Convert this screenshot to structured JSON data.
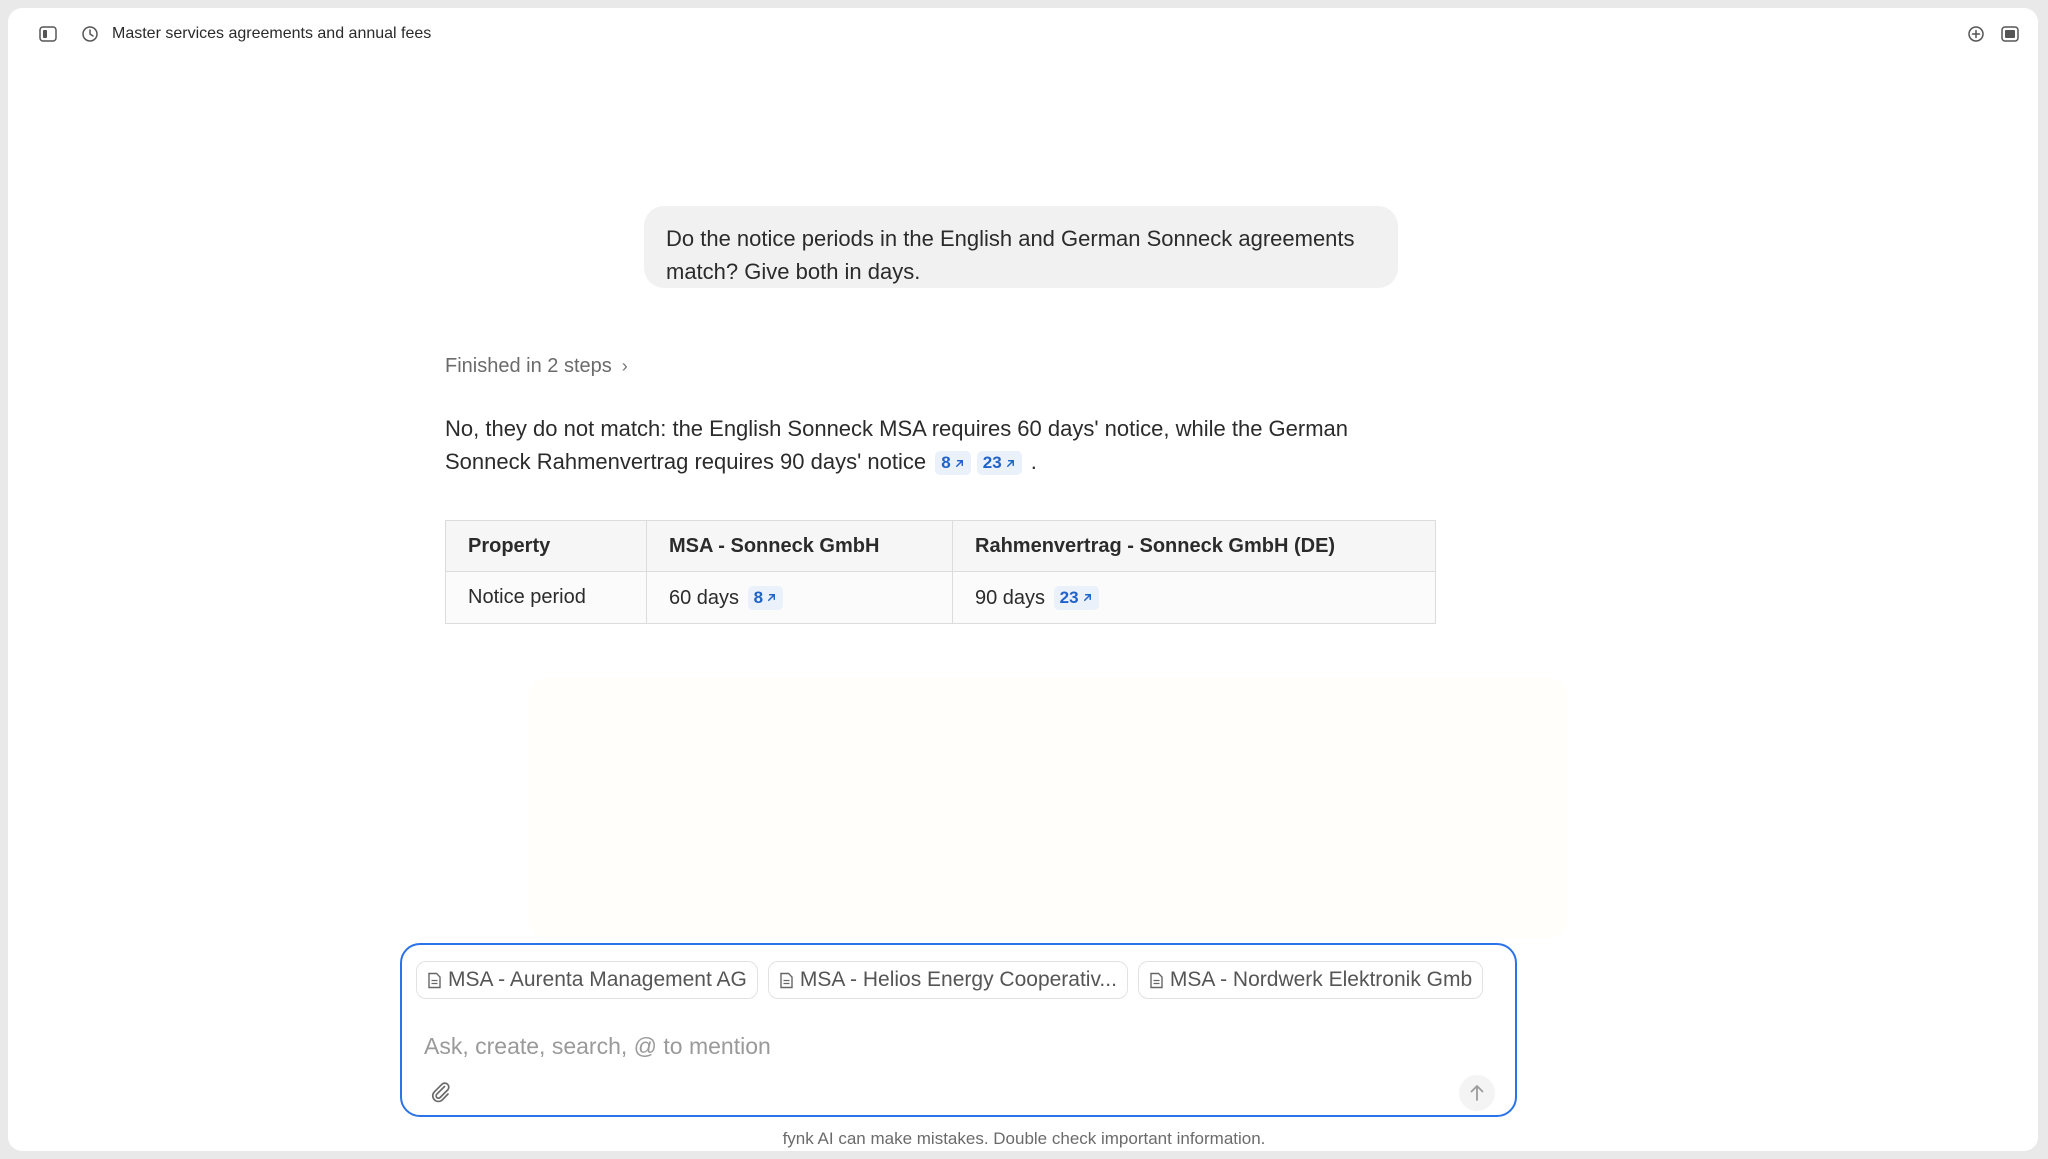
{
  "header": {
    "title": "Master services agreements and annual fees",
    "icons": [
      "sidebar-toggle-icon",
      "history-icon",
      "new-chat-icon",
      "panel-icon"
    ]
  },
  "conversation": {
    "user_message": "Do the notice periods in the English and German Sonneck agreements match? Give both in days.",
    "steps_label": "Finished in 2 steps",
    "answer_text": "No, they do not match: the English Sonneck MSA requires 60 days' notice, while the German Sonneck Rahmenvertrag requires 90 days' notice",
    "answer_end": ".",
    "answer_citations": [
      "8",
      "23"
    ]
  },
  "table": {
    "headers": [
      "Property",
      "MSA - Sonneck GmbH",
      "Rahmenvertrag - Sonneck GmbH (DE)"
    ],
    "rows": [
      {
        "property": "Notice period",
        "msa": "60 days",
        "msa_cite": "8",
        "rahmen": "90 days",
        "rahmen_cite": "23"
      }
    ]
  },
  "composer": {
    "chips": [
      "MSA - Aurenta Management AG",
      "MSA - Helios Energy Cooperativ...",
      "MSA - Nordwerk Elektronik Gmb"
    ],
    "placeholder": "Ask, create, search, @ to mention"
  },
  "footer": {
    "disclaimer": "fynk AI can make mistakes. Double check important information."
  },
  "colors": {
    "accent": "#2a73e8",
    "citation_bg": "#eaf1fb",
    "citation_text": "#1f62c9"
  }
}
